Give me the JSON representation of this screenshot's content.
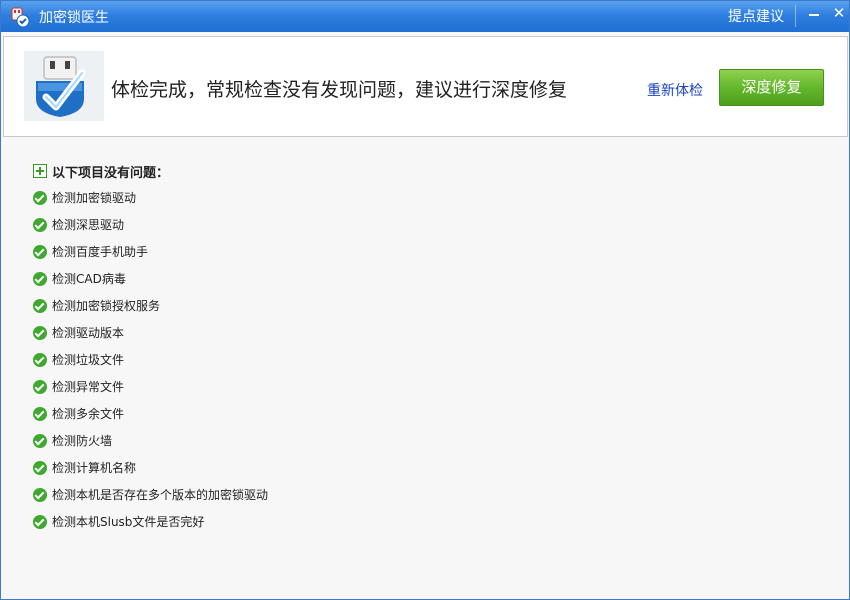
{
  "window": {
    "title": "加密锁医生",
    "suggest_label": "提点建议"
  },
  "header": {
    "headline": "体检完成，常规检查没有发现问题，建议进行深度修复",
    "recheck_label": "重新体检",
    "repair_label": "深度修复"
  },
  "list": {
    "header": "以下项目没有问题：",
    "items": [
      {
        "label": "检测加密锁驱动"
      },
      {
        "label": "检测深思驱动"
      },
      {
        "label": "检测百度手机助手"
      },
      {
        "label": "检测CAD病毒"
      },
      {
        "label": "检测加密锁授权服务"
      },
      {
        "label": "检测驱动版本"
      },
      {
        "label": "检测垃圾文件"
      },
      {
        "label": "检测异常文件"
      },
      {
        "label": "检测多余文件"
      },
      {
        "label": "检测防火墙"
      },
      {
        "label": "检测计算机名称"
      },
      {
        "label": "检测本机是否存在多个版本的加密锁驱动"
      },
      {
        "label": "检测本机Slusb文件是否完好"
      }
    ]
  },
  "icons": {
    "app": "app-icon",
    "logo": "usb-dongle-check-icon",
    "list_header": "expand-plus-icon",
    "item_status": "check-circle-icon"
  },
  "colors": {
    "titlebar": "#2f7fe0",
    "accent_green": "#64b82c",
    "link_blue": "#1a44b8",
    "ok_green": "#3fa82f"
  }
}
